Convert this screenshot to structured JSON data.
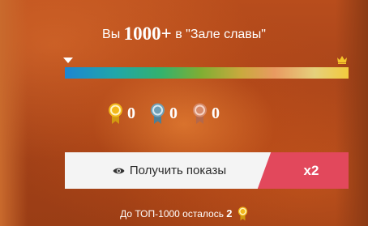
{
  "headline": {
    "prefix": "Вы",
    "rank": "1000+",
    "suffix": "в \"Зале славы\""
  },
  "progress": {
    "position_fraction": 0.0,
    "left_marker_icon": "triangle-down-icon",
    "right_marker_icon": "crown-icon",
    "colors": [
      "#1d86d2",
      "#20a7a9",
      "#33b26d",
      "#7fae33",
      "#c9aa3e",
      "#e99a61",
      "#e5d07c",
      "#f2cb3d"
    ]
  },
  "medals": [
    {
      "icon": "gold-medal-icon",
      "count": "0",
      "color": "#f2b81a"
    },
    {
      "icon": "silver-medal-icon",
      "count": "0",
      "color": "#6f9fb5"
    },
    {
      "icon": "bronze-medal-icon",
      "count": "0",
      "color": "#d68a6a"
    }
  ],
  "cta": {
    "label": "Получить показы",
    "icon": "eye-icon",
    "multiplier": "x2",
    "accent_color": "#e2485c"
  },
  "footer": {
    "text": "До ТОП-1000 осталось",
    "count": "2",
    "icon": "gold-medal-icon"
  }
}
